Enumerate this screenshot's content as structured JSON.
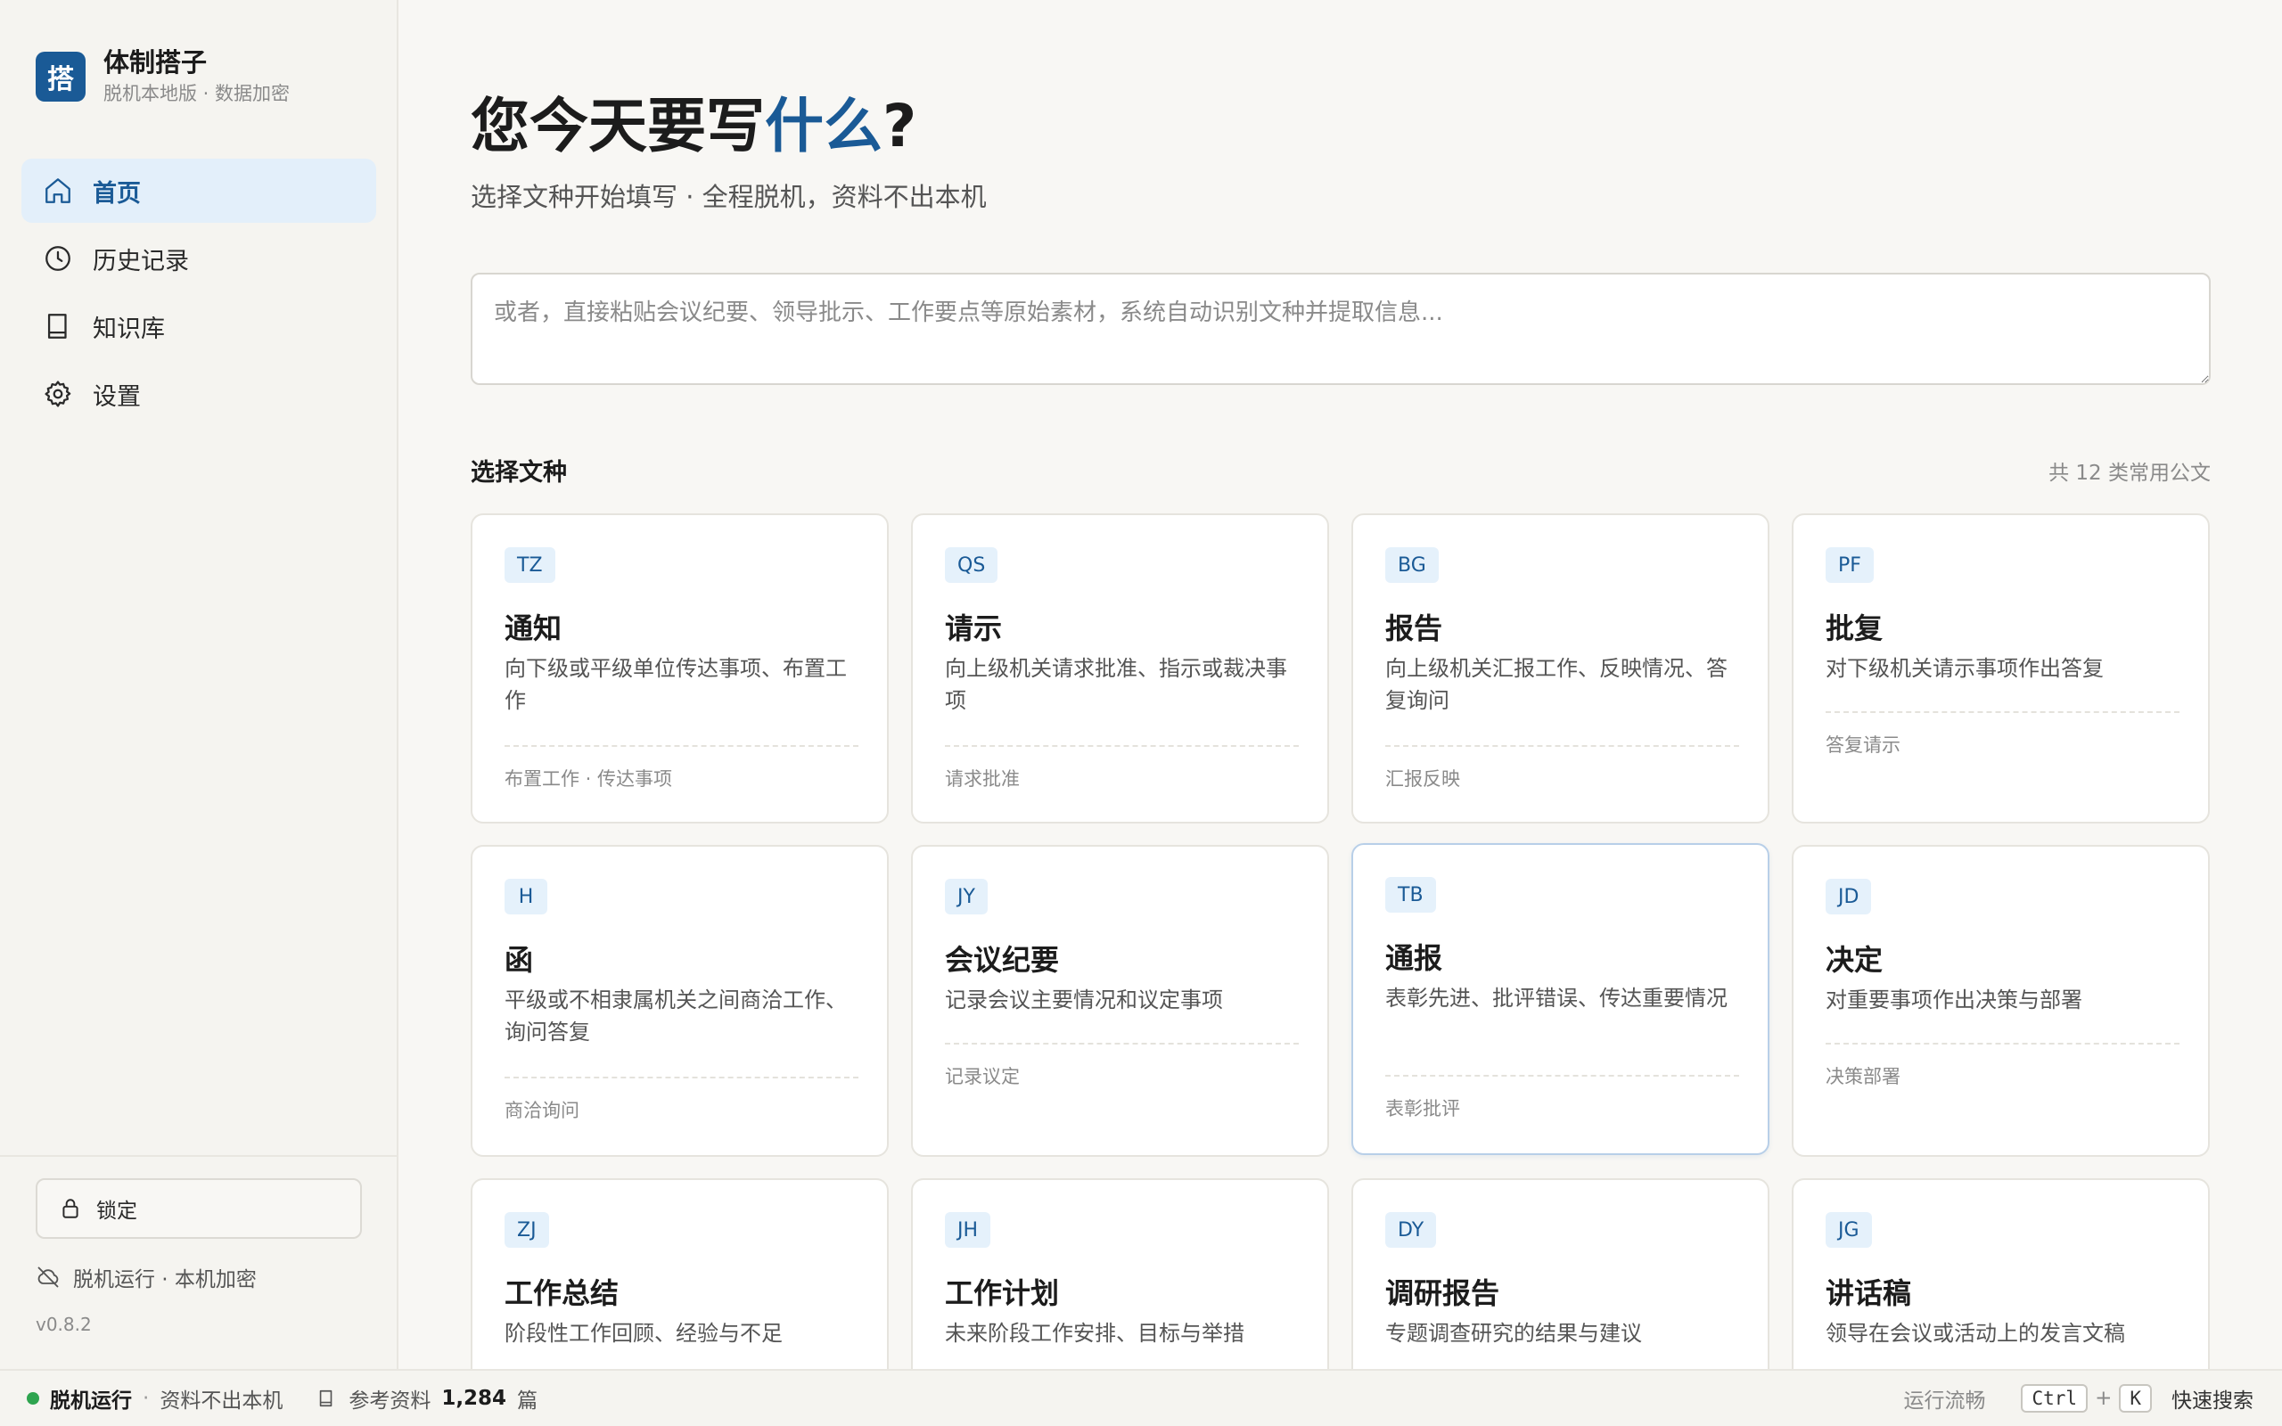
{
  "brand": {
    "logo_char": "搭",
    "name": "体制搭子",
    "subtitle": "脱机本地版 · 数据加密"
  },
  "nav": [
    {
      "label": "首页",
      "icon": "home-icon",
      "active": true
    },
    {
      "label": "历史记录",
      "icon": "clock-icon",
      "active": false
    },
    {
      "label": "知识库",
      "icon": "book-icon",
      "active": false
    },
    {
      "label": "设置",
      "icon": "gear-icon",
      "active": false
    }
  ],
  "sidebar_bottom": {
    "lock_label": "锁定",
    "offline_note": "脱机运行 · 本机加密",
    "version": "v0.8.2"
  },
  "hero": {
    "title_prefix": "您今天要写",
    "title_accent": "什么",
    "title_suffix": "?",
    "subtitle": "选择文种开始填写 · 全程脱机，资料不出本机"
  },
  "paste": {
    "placeholder": "或者，直接粘贴会议纪要、领导批示、工作要点等原始素材，系统自动识别文种并提取信息...",
    "value": ""
  },
  "section": {
    "title": "选择文种",
    "count_text": "共 12 类常用公文"
  },
  "doc_types": [
    {
      "code": "TZ",
      "title": "通知",
      "desc": "向下级或平级单位传达事项、布置工作",
      "tag": "布置工作 · 传达事项"
    },
    {
      "code": "QS",
      "title": "请示",
      "desc": "向上级机关请求批准、指示或裁决事项",
      "tag": "请求批准"
    },
    {
      "code": "BG",
      "title": "报告",
      "desc": "向上级机关汇报工作、反映情况、答复询问",
      "tag": "汇报反映"
    },
    {
      "code": "PF",
      "title": "批复",
      "desc": "对下级机关请示事项作出答复",
      "tag": "答复请示"
    },
    {
      "code": "H",
      "title": "函",
      "desc": "平级或不相隶属机关之间商洽工作、询问答复",
      "tag": "商洽询问"
    },
    {
      "code": "JY",
      "title": "会议纪要",
      "desc": "记录会议主要情况和议定事项",
      "tag": "记录议定"
    },
    {
      "code": "TB",
      "title": "通报",
      "desc": "表彰先进、批评错误、传达重要情况",
      "tag": "表彰批评"
    },
    {
      "code": "JD",
      "title": "决定",
      "desc": "对重要事项作出决策与部署",
      "tag": "决策部署"
    },
    {
      "code": "ZJ",
      "title": "工作总结",
      "desc": "阶段性工作回顾、经验与不足",
      "tag": ""
    },
    {
      "code": "JH",
      "title": "工作计划",
      "desc": "未来阶段工作安排、目标与举措",
      "tag": ""
    },
    {
      "code": "DY",
      "title": "调研报告",
      "desc": "专题调查研究的结果与建议",
      "tag": ""
    },
    {
      "code": "JG",
      "title": "讲话稿",
      "desc": "领导在会议或活动上的发言文稿",
      "tag": ""
    }
  ],
  "statusbar": {
    "status_label": "脱机运行",
    "status_note": "资料不出本机",
    "refs_label": "参考资料",
    "refs_count": "1,284",
    "refs_unit": "篇",
    "perf": "运行流畅",
    "key1": "Ctrl",
    "key2": "K",
    "search_label": "快速搜索"
  },
  "colors": {
    "accent": "#1a5a96",
    "accent_bg": "#e3effa",
    "online": "#2ea44f"
  }
}
